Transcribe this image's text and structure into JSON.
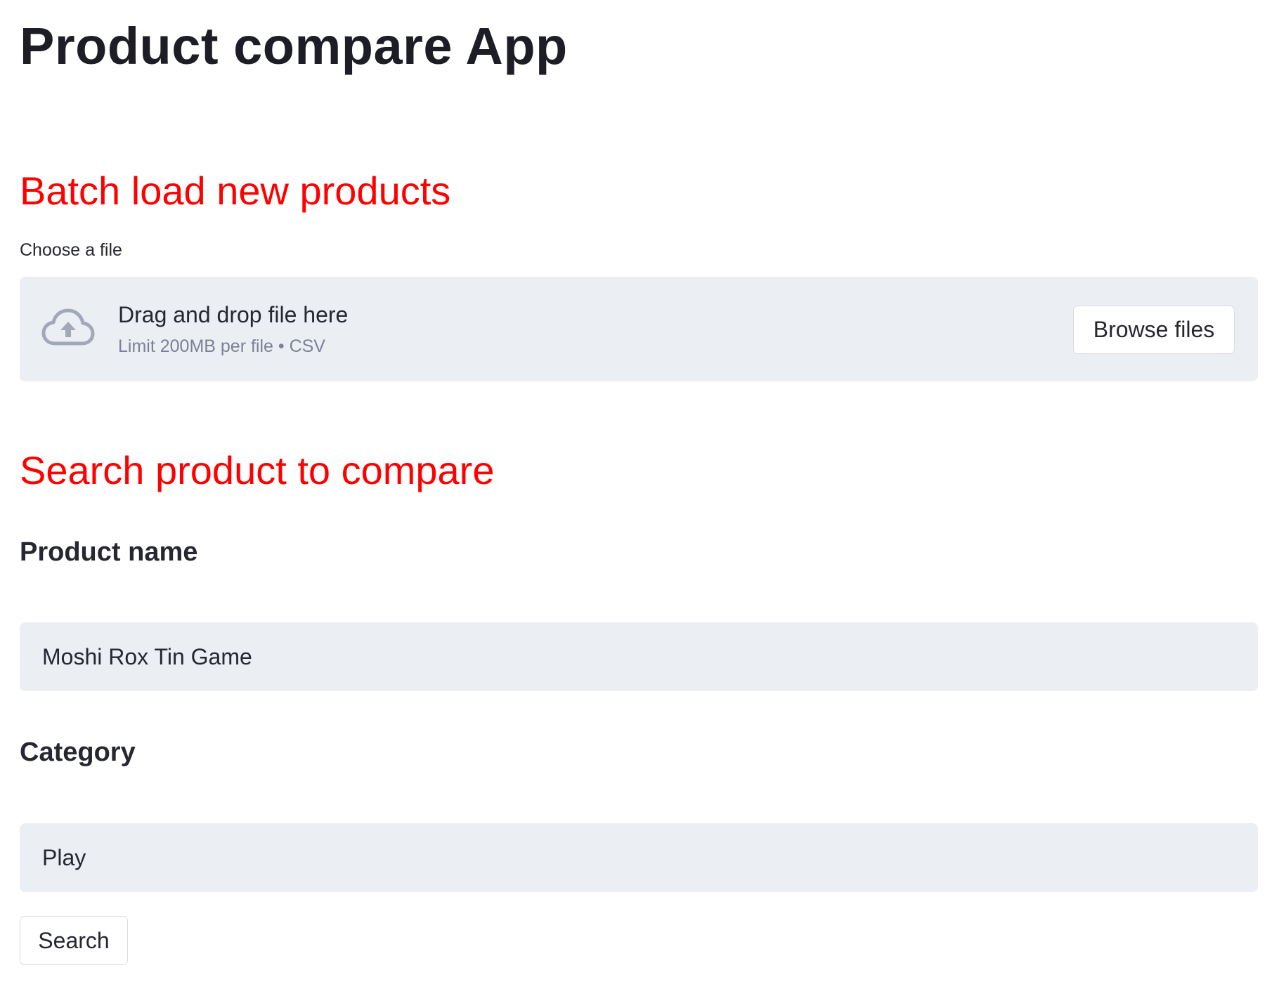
{
  "app": {
    "title": "Product compare App"
  },
  "batch": {
    "heading": "Batch load new products",
    "uploader": {
      "label": "Choose a file",
      "icon": "cloud-upload-icon",
      "drag_text": "Drag and drop file here",
      "limit_text": "Limit 200MB per file • CSV",
      "browse_label": "Browse files"
    }
  },
  "search": {
    "heading": "Search product to compare",
    "product_name": {
      "label": "Product name",
      "value": "Moshi Rox Tin Game"
    },
    "category": {
      "label": "Category",
      "value": "Play"
    },
    "button_label": "Search"
  },
  "colors": {
    "heading_accent": "#ff0000",
    "input_background": "#ebeef3",
    "text": "#262730",
    "muted_text": "#7d8193"
  }
}
